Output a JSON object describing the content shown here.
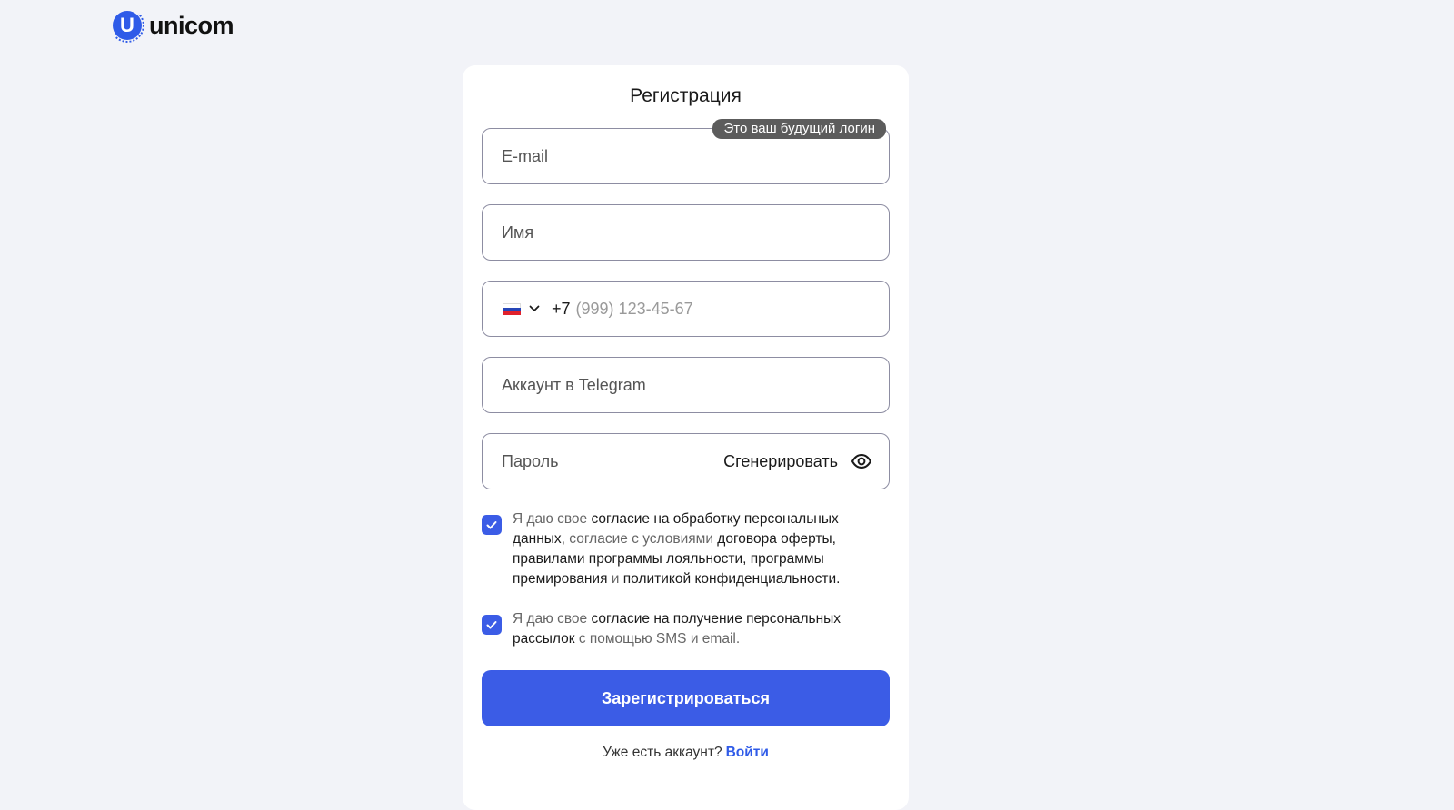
{
  "brand": {
    "name": "unicom",
    "mark": "U",
    "color": "#2f5be8"
  },
  "form": {
    "title": "Регистрация",
    "email": {
      "placeholder": "E-mail",
      "badge": "Это ваш будущий логин"
    },
    "name": {
      "placeholder": "Имя"
    },
    "phone": {
      "country_code": "+7",
      "placeholder": "(999) 123-45-67",
      "country": "RU"
    },
    "telegram": {
      "placeholder": "Аккаунт в Telegram"
    },
    "password": {
      "placeholder": "Пароль",
      "generate_label": "Сгенерировать"
    },
    "consents": [
      {
        "checked": true,
        "parts": [
          {
            "text": "Я даю свое ",
            "muted": true
          },
          {
            "text": "согласие на обработку персональных данных",
            "muted": false
          },
          {
            "text": ", согласие с условиями ",
            "muted": true
          },
          {
            "text": "договора оферты, правилами программы лояльности, программы премирования",
            "muted": false
          },
          {
            "text": " и ",
            "muted": true
          },
          {
            "text": "политикой конфиденциальности.",
            "muted": false
          }
        ]
      },
      {
        "checked": true,
        "parts": [
          {
            "text": "Я даю свое ",
            "muted": true
          },
          {
            "text": "согласие на получение персональных рассылок",
            "muted": false
          },
          {
            "text": " с помощью SMS и email.",
            "muted": true
          }
        ]
      }
    ],
    "submit_label": "Зарегистрироваться",
    "login_prompt": "Уже есть аккаунт?",
    "login_link": "Войти"
  },
  "colors": {
    "accent": "#3b5ce6",
    "background": "#f2f3f8",
    "border": "#8d8da2"
  }
}
